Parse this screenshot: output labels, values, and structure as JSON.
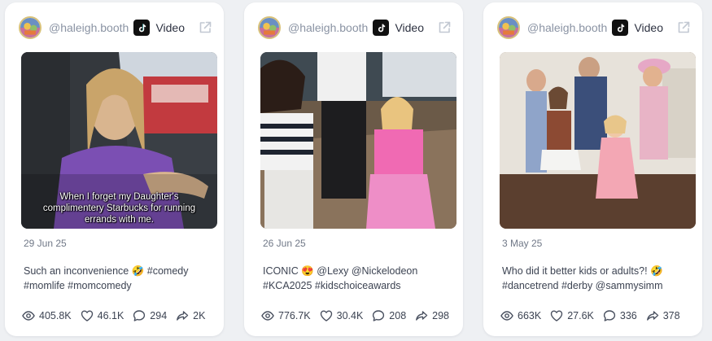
{
  "cards": [
    {
      "handle": "@haleigh.booth",
      "platform_label": "Video",
      "platform_icon": "tiktok-icon",
      "thumbnail_caption": "When I forget my Daughter's complimentery Starbucks for running errands with me.",
      "date": "29 Jun 25",
      "description": "Such an inconvenience 🤣 #comedy #momlife #momcomedy",
      "stats": {
        "views": "405.8K",
        "likes": "46.1K",
        "comments": "294",
        "shares": "2K"
      }
    },
    {
      "handle": "@haleigh.booth",
      "platform_label": "Video",
      "platform_icon": "tiktok-icon",
      "thumbnail_caption": "",
      "date": "26 Jun 25",
      "description": "ICONIC 😍 @Lexy @Nickelodeon #KCA2025 #kidschoiceawards",
      "stats": {
        "views": "776.7K",
        "likes": "30.4K",
        "comments": "208",
        "shares": "298"
      }
    },
    {
      "handle": "@haleigh.booth",
      "platform_label": "Video",
      "platform_icon": "tiktok-icon",
      "thumbnail_caption": "",
      "date": "3 May 25",
      "description": "Who did it better kids or adults?! 🤣 #dancetrend #derby @sammysimm",
      "stats": {
        "views": "663K",
        "likes": "27.6K",
        "comments": "336",
        "shares": "378"
      }
    }
  ],
  "colors": {
    "page_background": "#eef0f3",
    "card_background": "#ffffff",
    "handle_text": "#8a93a3",
    "body_text": "#3c4352",
    "meta_text": "#707887"
  },
  "stat_icons": [
    "eye-icon",
    "heart-icon",
    "comment-icon",
    "share-icon"
  ]
}
